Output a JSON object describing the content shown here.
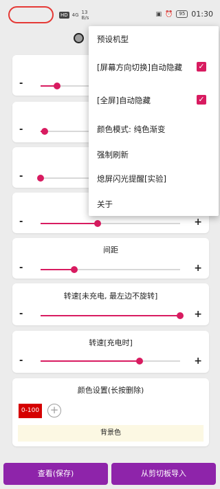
{
  "status_bar": {
    "hd": "HD",
    "signal": "4G",
    "net_speed_value": "13",
    "net_speed_unit": "B/s",
    "battery": "95",
    "time": "01:30"
  },
  "cards": [
    {
      "title": "",
      "value": 0.12
    },
    {
      "title": "",
      "value": 0.03
    },
    {
      "title": "",
      "value": 0.0
    },
    {
      "title": "",
      "value": 0.41
    },
    {
      "title": "间距",
      "value": 0.24
    },
    {
      "title": "转速[未充电, 最左边不旋转]",
      "value": 1.0
    },
    {
      "title": "转速[充电时]",
      "value": 0.71
    }
  ],
  "controls": {
    "minus": "-",
    "plus": "+"
  },
  "color_settings": {
    "title": "颜色设置(长按删除)",
    "chip_label": "0-100",
    "chip_color": "#d50000",
    "add_symbol": "+",
    "background_label": "背景色"
  },
  "buttons": {
    "view_save": "查看(保存)",
    "import_clipboard": "从剪切板导入"
  },
  "menu": {
    "items": [
      {
        "label": "预设机型"
      },
      {
        "label": "[屏幕方向切换]自动隐藏",
        "checked": true
      },
      {
        "label": "[全屏]自动隐藏",
        "checked": true
      },
      {
        "label": "颜色模式: 纯色渐变"
      },
      {
        "label": "强制刷新"
      },
      {
        "label": "熄屏闪光提醒[实验]"
      },
      {
        "label": "关于"
      }
    ],
    "check_symbol": "✓"
  },
  "colors": {
    "accent": "#d81b60",
    "button": "#8e24aa",
    "status_pill": "#e53935"
  }
}
